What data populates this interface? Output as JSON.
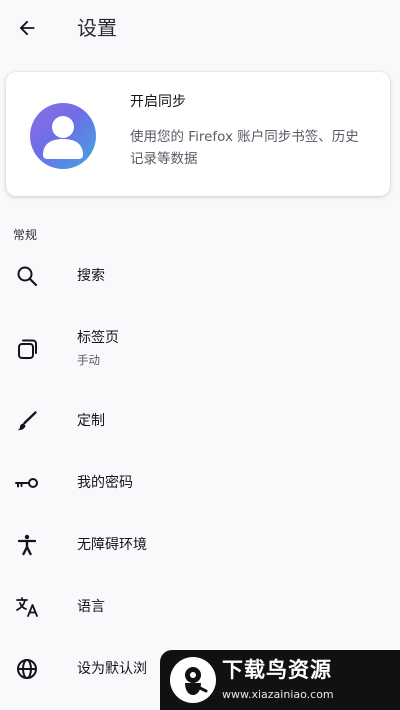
{
  "header": {
    "title": "设置"
  },
  "sync": {
    "title": "开启同步",
    "description": "使用您的 Firefox 账户同步书签、历史记录等数据"
  },
  "general": {
    "section_label": "常规",
    "items": [
      {
        "label": "搜索",
        "icon": "search-icon"
      },
      {
        "label": "标签页",
        "sublabel": "手动",
        "icon": "tabs-icon"
      },
      {
        "label": "定制",
        "icon": "brush-icon"
      },
      {
        "label": "我的密码",
        "icon": "key-icon"
      },
      {
        "label": "无障碍环境",
        "icon": "accessibility-icon"
      },
      {
        "label": "语言",
        "icon": "translate-icon"
      },
      {
        "label": "设为默认浏",
        "icon": "globe-icon"
      }
    ]
  },
  "watermark": {
    "title": "下载鸟资源",
    "url": "www.xiazainiao.com"
  },
  "colors": {
    "background": "#f9f9fb",
    "text_primary": "#15141a",
    "text_secondary": "#5b5b66",
    "avatar_gradient_start": "#8f6de6",
    "avatar_gradient_end": "#3da8e0"
  }
}
